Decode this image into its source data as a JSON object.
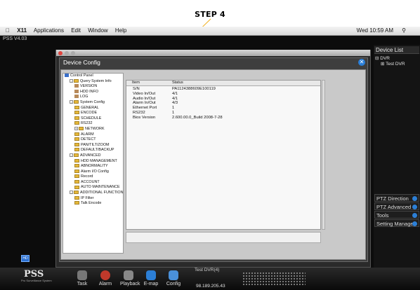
{
  "annotation": {
    "step_label": "STEP 4"
  },
  "menubar": {
    "apple": "",
    "app": "X11",
    "items": [
      "Applications",
      "Edit",
      "Window",
      "Help"
    ],
    "clock": "Wed 10:59 AM"
  },
  "pss": {
    "title": "PSS  V4.03"
  },
  "device_list": {
    "title": "Device List",
    "root": "DVR",
    "children": [
      "Test DVR"
    ]
  },
  "right_buttons": [
    "PTZ Direction",
    "PTZ Advanced",
    "Tools",
    "Setting Manage"
  ],
  "dialog": {
    "title": "Device Config",
    "tree": [
      {
        "label": "Control Panel",
        "level": 0,
        "kind": "root"
      },
      {
        "label": "Query System Info",
        "level": 1,
        "kind": "folder",
        "exp": "-"
      },
      {
        "label": "VERSION",
        "level": 2,
        "kind": "leaf"
      },
      {
        "label": "HDD INFO",
        "level": 2,
        "kind": "leaf"
      },
      {
        "label": "LOG",
        "level": 2,
        "kind": "leaf"
      },
      {
        "label": "System Config",
        "level": 1,
        "kind": "folder",
        "exp": "-"
      },
      {
        "label": "GENERAL",
        "level": 2,
        "kind": "folder"
      },
      {
        "label": "ENCODE",
        "level": 2,
        "kind": "folder"
      },
      {
        "label": "SCHEDULE",
        "level": 2,
        "kind": "folder"
      },
      {
        "label": "RS232",
        "level": 2,
        "kind": "folder"
      },
      {
        "label": "NETWORK",
        "level": 2,
        "kind": "folder",
        "exp": "+"
      },
      {
        "label": "ALARM",
        "level": 2,
        "kind": "folder"
      },
      {
        "label": "DETECT",
        "level": 2,
        "kind": "folder"
      },
      {
        "label": "PAN/TILT/ZOOM",
        "level": 2,
        "kind": "folder"
      },
      {
        "label": "DEFAULT/BACKUP",
        "level": 2,
        "kind": "folder"
      },
      {
        "label": "ADVANCED",
        "level": 1,
        "kind": "folder",
        "exp": "-"
      },
      {
        "label": "HDD MANAGEMENT",
        "level": 2,
        "kind": "folder"
      },
      {
        "label": "ABNORMALITY",
        "level": 2,
        "kind": "folder"
      },
      {
        "label": "Alarm I/O Config",
        "level": 2,
        "kind": "folder"
      },
      {
        "label": "Record",
        "level": 2,
        "kind": "folder"
      },
      {
        "label": "ACCOUNT",
        "level": 2,
        "kind": "folder"
      },
      {
        "label": "AUTO MAINTENANCE",
        "level": 2,
        "kind": "folder"
      },
      {
        "label": "ADDITIONAL FUNCTION",
        "level": 1,
        "kind": "folder",
        "exp": "-"
      },
      {
        "label": "IP Filter",
        "level": 2,
        "kind": "folder"
      },
      {
        "label": "Talk Encode",
        "level": 2,
        "kind": "folder"
      }
    ],
    "table": {
      "headers": [
        "Item",
        "Status"
      ],
      "rows": [
        [
          "S/N",
          "PA1124388609E100119"
        ],
        [
          "Video In/Out",
          "4/1"
        ],
        [
          "Audio In/Out",
          "4/1"
        ],
        [
          "Alarm In/Out",
          "4/3"
        ],
        [
          "Ethernet Port",
          "1"
        ],
        [
          "RS232",
          "1"
        ],
        [
          "Bios Version",
          "2.600.00.0_Build 2008-7-28"
        ]
      ]
    }
  },
  "taskbar": {
    "logo": "PSS",
    "subtitle": "Pro Surveillance System",
    "buttons": [
      "Task",
      "Alarm",
      "Playback",
      "E-map",
      "Config"
    ],
    "device_label": "Test DVR(4)",
    "ip": "98.189.205.43"
  },
  "colors": {
    "accent_blue": "#2a7fd9",
    "annotation_line": "#f0b020"
  }
}
